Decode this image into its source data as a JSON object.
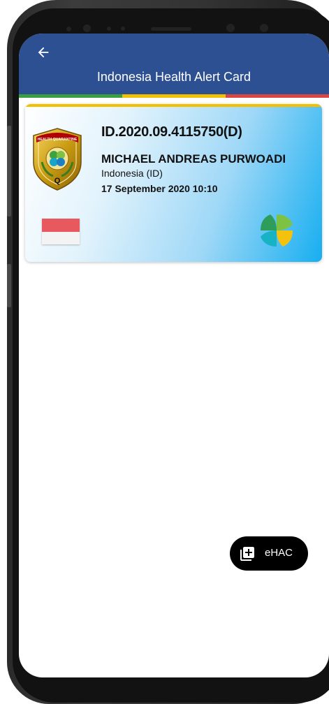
{
  "appbar": {
    "title": "Indonesia Health Alert Card",
    "back_icon": "arrow-left-icon",
    "stripe_colors": [
      "#3a9f3e",
      "#f2c000",
      "#d94646"
    ]
  },
  "card": {
    "id": "ID.2020.09.4115750(D)",
    "name": "MICHAEL ANDREAS PURWOADI",
    "country": "Indonesia (ID)",
    "datetime": "17 September 2020 10:10",
    "emblem_icon": "health-quarantine-emblem-icon",
    "emblem_text": "HEALTH QUARANTINE",
    "emblem_letter": "Q",
    "flag_icon": "indonesia-flag-icon",
    "ministry_logo_icon": "kemenkes-logo-icon"
  },
  "fab": {
    "label": "eHAC",
    "icon": "library-add-icon"
  },
  "colors": {
    "appbar": "#2d5093",
    "card_gradient_end": "#17aef0",
    "fab": "#000000"
  }
}
